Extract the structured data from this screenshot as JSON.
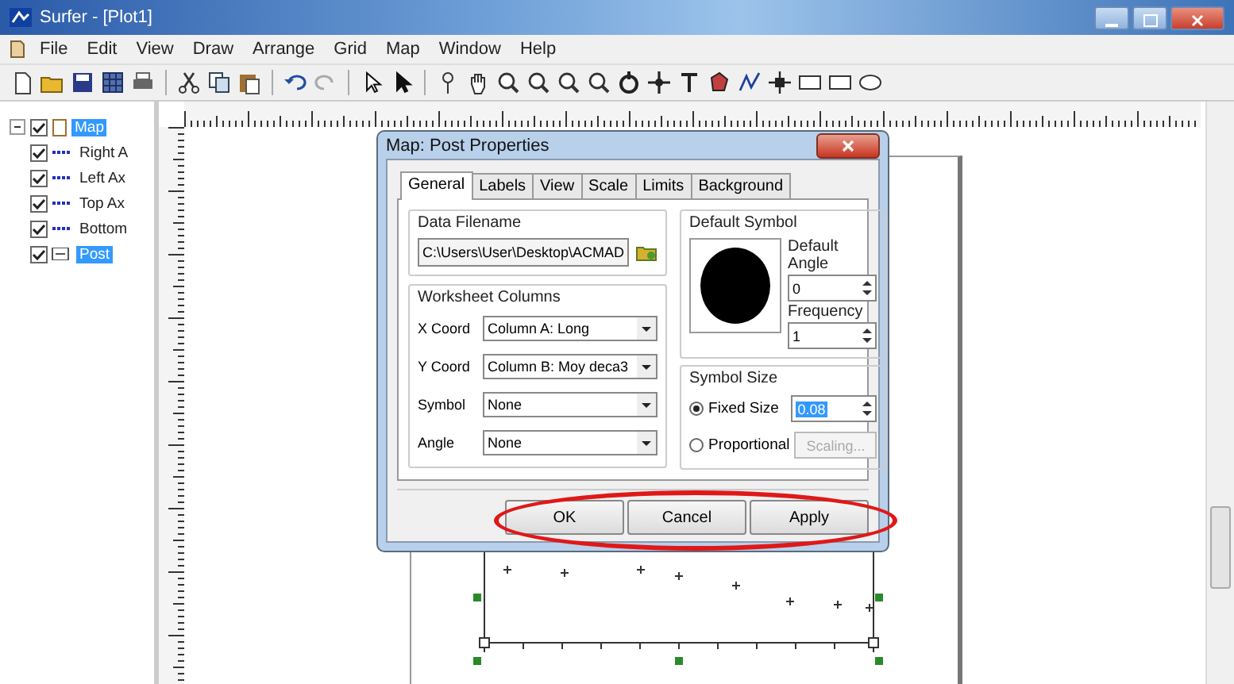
{
  "window": {
    "title": "Surfer - [Plot1]"
  },
  "menu": [
    "File",
    "Edit",
    "View",
    "Draw",
    "Arrange",
    "Grid",
    "Map",
    "Window",
    "Help"
  ],
  "object_tree": [
    {
      "label": "Map",
      "checked": true,
      "selected": true,
      "expanded": true,
      "children": [
        {
          "label": "Right A",
          "checked": true,
          "selected": false
        },
        {
          "label": "Left Ax",
          "checked": true,
          "selected": false
        },
        {
          "label": "Top Ax",
          "checked": true,
          "selected": false
        },
        {
          "label": "Bottom",
          "checked": true,
          "selected": false
        },
        {
          "label": "Post",
          "checked": true,
          "selected": true
        }
      ]
    }
  ],
  "dialog": {
    "title": "Map: Post Properties",
    "tabs": [
      {
        "label": "General",
        "selected": true
      },
      {
        "label": "Labels",
        "selected": false
      },
      {
        "label": "View",
        "selected": false
      },
      {
        "label": "Scale",
        "selected": false
      },
      {
        "label": "Limits",
        "selected": false
      },
      {
        "label": "Background",
        "selected": false
      }
    ],
    "data_filename": {
      "title": "Data Filename",
      "value": "C:\\Users\\User\\Desktop\\ACMAD"
    },
    "worksheet_columns": {
      "title": "Worksheet Columns",
      "rows": [
        {
          "label": "X Coord",
          "value": "Column A:  Long"
        },
        {
          "label": "Y Coord",
          "value": "Column B:  Moy deca3"
        },
        {
          "label": "Symbol",
          "value": "None"
        },
        {
          "label": "Angle",
          "value": "None"
        }
      ]
    },
    "default_symbol": {
      "title": "Default Symbol",
      "angle_label": "Default Angle",
      "angle": "0",
      "frequency_label": "Frequency",
      "frequency": "1"
    },
    "symbol_size": {
      "title": "Symbol Size",
      "options": [
        {
          "label": "Fixed Size",
          "selected": true
        },
        {
          "label": "Proportional",
          "selected": false
        }
      ],
      "size": "0.08",
      "scaling_button": {
        "label": "Scaling...",
        "disabled": true
      }
    },
    "buttons": [
      "OK",
      "Cancel",
      "Apply"
    ]
  }
}
